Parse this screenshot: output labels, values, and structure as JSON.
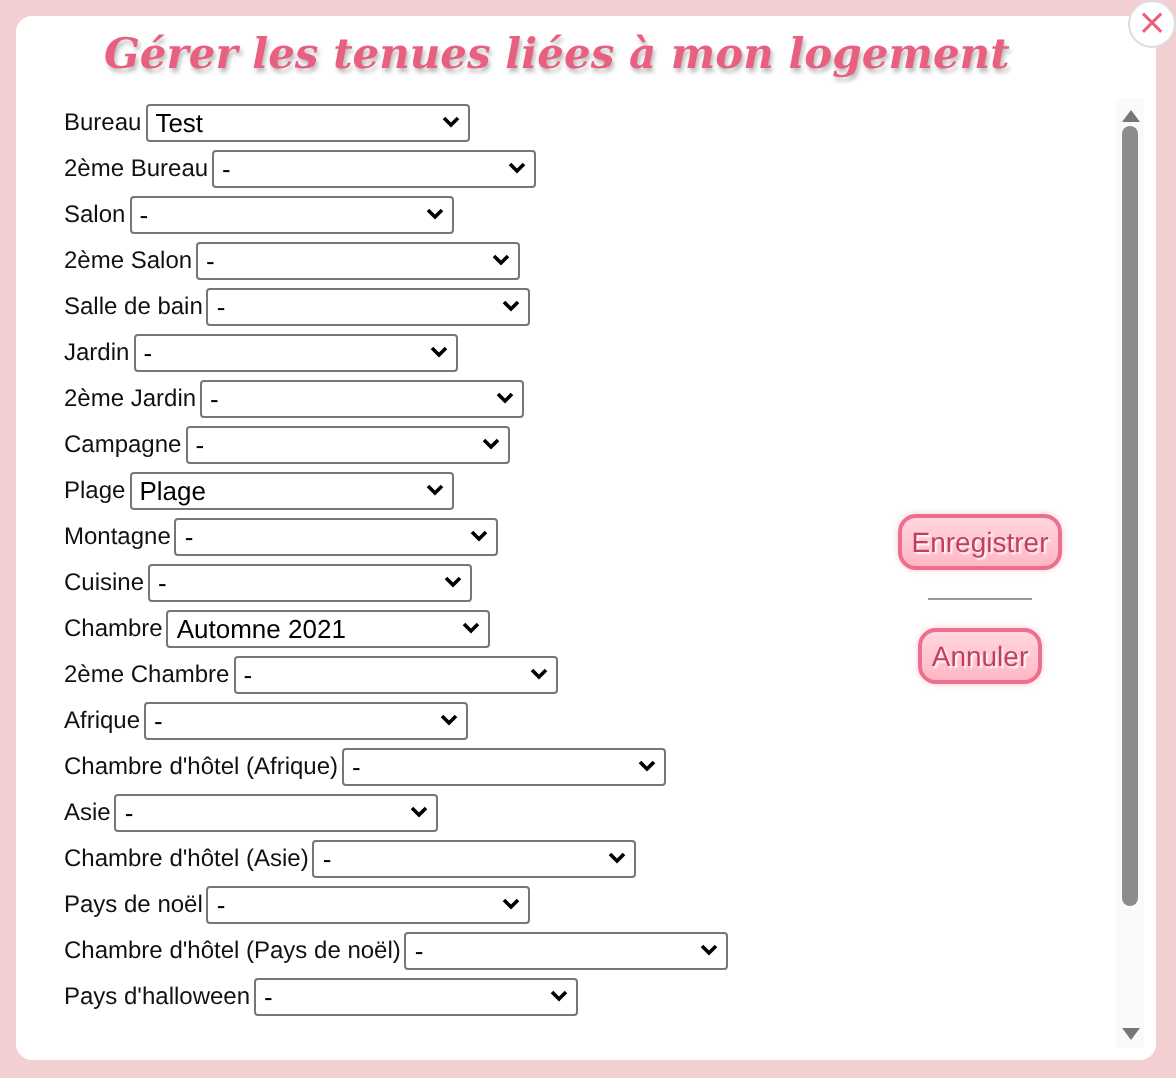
{
  "dialog": {
    "title": "Gérer les tenues liées à mon logement",
    "close": "×"
  },
  "rows": [
    {
      "label": "Bureau",
      "select": {
        "value": "Test"
      }
    },
    {
      "label": "2ème Bureau",
      "select": {
        "value": "-"
      }
    },
    {
      "label": "Salon",
      "select": {
        "value": "-"
      }
    },
    {
      "label": "2ème Salon",
      "select": {
        "value": "-"
      }
    },
    {
      "label": "Salle de bain",
      "select": {
        "value": "-"
      }
    },
    {
      "label": "Jardin",
      "select": {
        "value": "-"
      }
    },
    {
      "label": "2ème Jardin",
      "select": {
        "value": "-"
      }
    },
    {
      "label": "Campagne",
      "select": {
        "value": "-"
      }
    },
    {
      "label": "Plage",
      "select": {
        "value": "Plage"
      }
    },
    {
      "label": "Montagne",
      "select": {
        "value": "-"
      }
    },
    {
      "label": "Cuisine",
      "select": {
        "value": "-"
      }
    },
    {
      "label": "Chambre",
      "select": {
        "value": "Automne 2021"
      }
    },
    {
      "label": "2ème Chambre",
      "select": {
        "value": "-"
      }
    },
    {
      "label": "Afrique",
      "select": {
        "value": "-"
      }
    },
    {
      "label": "Chambre d'hôtel (Afrique)",
      "select": {
        "value": "-"
      }
    },
    {
      "label": "Asie",
      "select": {
        "value": "-"
      }
    },
    {
      "label": "Chambre d'hôtel (Asie)",
      "select": {
        "value": "-"
      }
    },
    {
      "label": "Pays de noël",
      "select": {
        "value": "-"
      }
    },
    {
      "label": "Chambre d'hôtel (Pays de noël)",
      "select": {
        "value": "-"
      }
    },
    {
      "label": "Pays d'halloween",
      "select": {
        "value": "-"
      }
    }
  ],
  "buttons": [
    {
      "label": "Enregistrer"
    },
    {
      "label": "Annuler"
    }
  ]
}
